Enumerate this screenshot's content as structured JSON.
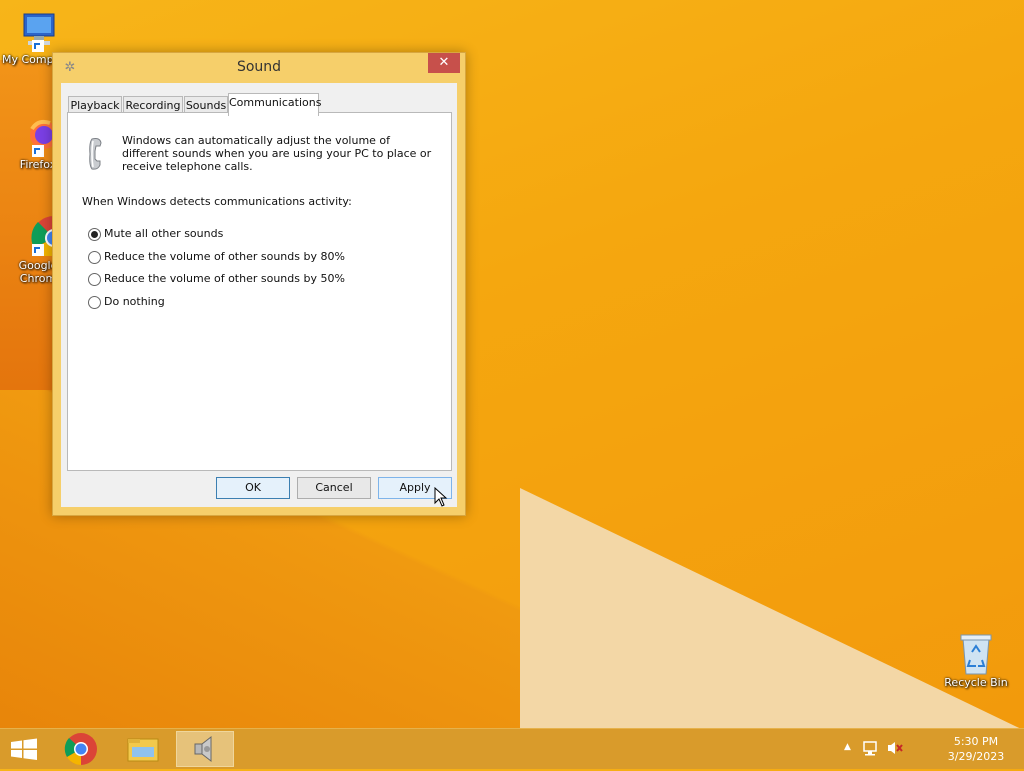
{
  "desktop": {
    "icons": [
      {
        "label": "My Comp",
        "icon": "computer-icon"
      },
      {
        "label": "Firefox",
        "icon": "firefox-icon"
      },
      {
        "label": "Google Chrome",
        "line1": "Google",
        "line2": "Chrom",
        "icon": "chrome-icon"
      },
      {
        "label": "Recycle Bin",
        "icon": "recycle-bin-icon"
      }
    ]
  },
  "window": {
    "title": "Sound",
    "close_glyph": "✕",
    "tabs": [
      {
        "label": "Playback"
      },
      {
        "label": "Recording"
      },
      {
        "label": "Sounds"
      },
      {
        "label": "Communications",
        "selected": true
      }
    ],
    "description": "Windows can automatically adjust the volume of different sounds when you are using your PC to place or receive telephone calls.",
    "detect_label": "When Windows detects communications activity:",
    "options": [
      {
        "label": "Mute all other sounds",
        "selected": true
      },
      {
        "label": "Reduce the volume of other sounds by 80%",
        "selected": false
      },
      {
        "label": "Reduce the volume of other sounds by 50%",
        "selected": false
      },
      {
        "label": "Do nothing",
        "selected": false
      }
    ],
    "buttons": {
      "ok": "OK",
      "cancel": "Cancel",
      "apply": "Apply"
    }
  },
  "taskbar": {
    "apps": [
      "start-icon",
      "chrome-icon",
      "file-explorer-icon",
      "speaker-icon"
    ],
    "clock": {
      "time": "5:30 PM",
      "date": "3/29/2023"
    }
  },
  "colors": {
    "accent": "#3c7fb1",
    "close": "#c7504b",
    "taskbar": "#d99b2b"
  }
}
